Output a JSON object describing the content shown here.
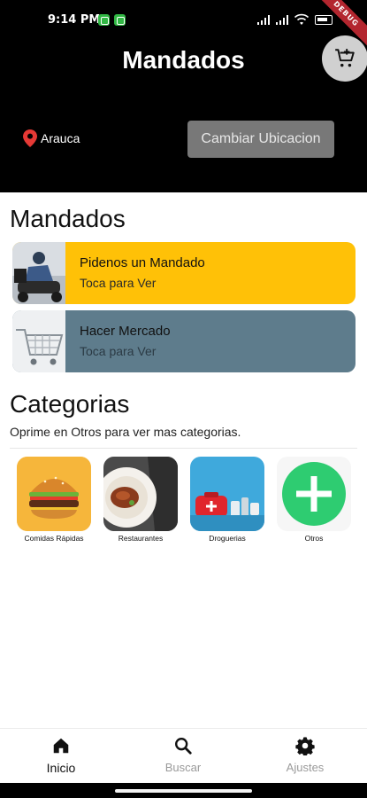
{
  "status_bar": {
    "time": "9:14 PM"
  },
  "debug_banner": "DEBUG",
  "header": {
    "title": "Mandados",
    "location": "Arauca",
    "change_location_label": "Cambiar Ubicacion"
  },
  "mandados": {
    "title": "Mandados",
    "items": [
      {
        "title": "Pidenos un Mandado",
        "subtitle": "Toca para Ver",
        "color": "#ffc107"
      },
      {
        "title": "Hacer Mercado",
        "subtitle": "Toca para Ver",
        "color": "#5e7c8c"
      }
    ]
  },
  "categorias": {
    "title": "Categorias",
    "hint": "Oprime en Otros para ver mas categorias.",
    "items": [
      {
        "label": "Comidas Rápidas"
      },
      {
        "label": "Restaurantes"
      },
      {
        "label": "Droguerias"
      },
      {
        "label": "Otros"
      }
    ]
  },
  "bottom_nav": {
    "items": [
      {
        "label": "Inicio",
        "icon": "home-icon"
      },
      {
        "label": "Buscar",
        "icon": "search-icon"
      },
      {
        "label": "Ajustes",
        "icon": "gear-icon"
      }
    ]
  },
  "colors": {
    "header_bg": "#000000",
    "accent_yellow": "#ffc107",
    "accent_slate": "#5e7c8c",
    "button_gray": "#787878",
    "location_pin": "#e53935",
    "otros_green": "#2ecc71"
  }
}
